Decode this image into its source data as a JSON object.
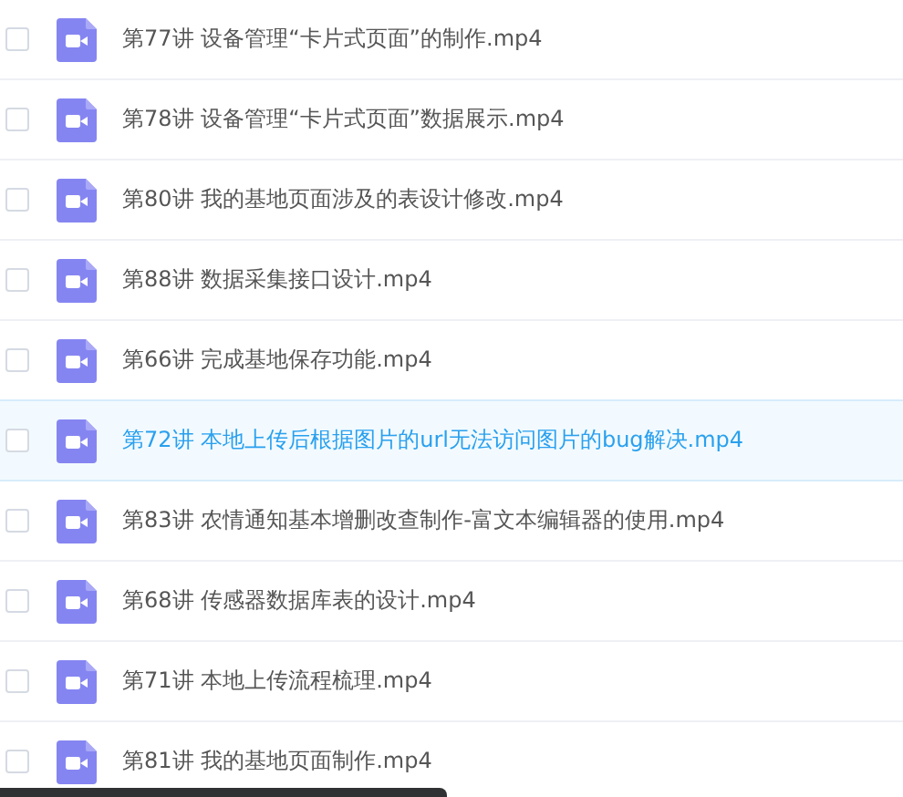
{
  "files": [
    {
      "name": "第77讲 设备管理“卡片式页面”的制作.mp4",
      "checked": false,
      "selected": false
    },
    {
      "name": "第78讲 设备管理“卡片式页面”数据展示.mp4",
      "checked": false,
      "selected": false
    },
    {
      "name": "第80讲 我的基地页面涉及的表设计修改.mp4",
      "checked": false,
      "selected": false
    },
    {
      "name": "第88讲 数据采集接口设计.mp4",
      "checked": false,
      "selected": false
    },
    {
      "name": "第66讲 完成基地保存功能.mp4",
      "checked": false,
      "selected": false
    },
    {
      "name": "第72讲 本地上传后根据图片的url无法访问图片的bug解决.mp4",
      "checked": false,
      "selected": true
    },
    {
      "name": "第83讲 农情通知基本增删改查制作-富文本编辑器的使用.mp4",
      "checked": false,
      "selected": false
    },
    {
      "name": "第68讲 传感器数据库表的设计.mp4",
      "checked": false,
      "selected": false
    },
    {
      "name": "第71讲 本地上传流程梳理.mp4",
      "checked": false,
      "selected": false
    },
    {
      "name": "第81讲 我的基地页面制作.mp4",
      "checked": false,
      "selected": false
    }
  ]
}
